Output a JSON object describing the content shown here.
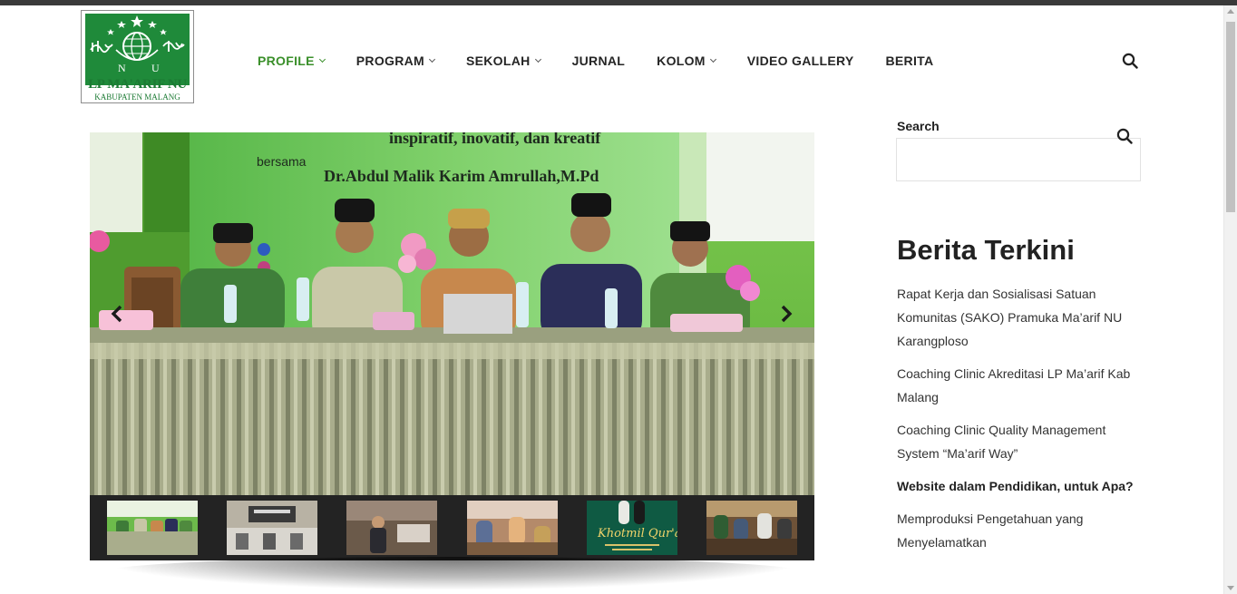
{
  "logo": {
    "title": "LP MA'ARIF NU",
    "subtitle": "KABUPATEN MALANG",
    "letters_left": "N",
    "letters_right": "U",
    "brand_green": "#1f8a3a"
  },
  "nav": {
    "items": [
      {
        "label": "PROFILE",
        "has_dropdown": true,
        "active": true
      },
      {
        "label": "PROGRAM",
        "has_dropdown": true,
        "active": false
      },
      {
        "label": "SEKOLAH",
        "has_dropdown": true,
        "active": false
      },
      {
        "label": "JURNAL",
        "has_dropdown": false,
        "active": false
      },
      {
        "label": "KOLOM",
        "has_dropdown": true,
        "active": false
      },
      {
        "label": "VIDEO GALLERY",
        "has_dropdown": false,
        "active": false
      },
      {
        "label": "BERITA",
        "has_dropdown": false,
        "active": false
      }
    ],
    "active_color": "#3a8f2a",
    "search_icon": "search-icon"
  },
  "slider": {
    "banner_line1": "inspiratif, inovatif, dan kreatif",
    "banner_prefix": "bersama",
    "banner_name": "Dr.Abdul Malik Karim Amrullah,M.Pd",
    "prev_icon": "chevron-left-icon",
    "next_icon": "chevron-right-icon",
    "thumbnail_count": 6,
    "thumb_khotmil": "Khotmil Qur'an"
  },
  "sidebar": {
    "search_label": "Search",
    "search_value": "",
    "search_icon": "search-icon",
    "recent_title": "Berita Terkini",
    "recent_posts": [
      "Rapat Kerja dan Sosialisasi Satuan Komunitas (SAKO) Pramuka Ma’arif NU Karangploso",
      "Coaching Clinic Akreditasi LP Ma’arif Kab Malang",
      "Coaching Clinic Quality Management System “Ma’arif Way”",
      "Website dalam Pendidikan, untuk Apa?",
      "Memproduksi Pengetahuan yang Menyelamatkan"
    ],
    "bold_index": 3
  }
}
